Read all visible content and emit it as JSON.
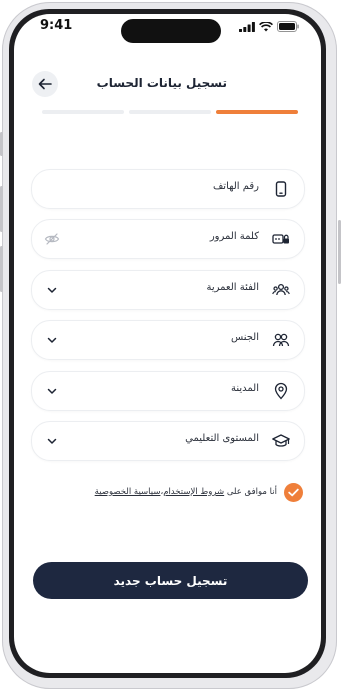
{
  "status_bar": {
    "time": "9:41"
  },
  "header": {
    "title": "تسجيل بيانات الحساب"
  },
  "progress": {
    "current_step": 1,
    "total_steps": 3
  },
  "fields": [
    {
      "label": "رقم الهاتف",
      "icon": "phone-icon",
      "left_icon": null
    },
    {
      "label": "كلمة المرور",
      "icon": "password-icon",
      "left_icon": "eye-off-icon"
    },
    {
      "label": "الفئة العمرية",
      "icon": "group-icon",
      "left_icon": "chevron-down-icon"
    },
    {
      "label": "الجنس",
      "icon": "gender-icon",
      "left_icon": "chevron-down-icon"
    },
    {
      "label": "المدينة",
      "icon": "location-pin-icon",
      "left_icon": "chevron-down-icon"
    },
    {
      "label": "المستوى التعليمي",
      "icon": "graduation-cap-icon",
      "left_icon": "chevron-down-icon"
    }
  ],
  "agreement": {
    "prefix": "أنا موافق على ",
    "terms": "شروط الإستخدام",
    "separator": "،",
    "privacy": "سياسية الخصوصية",
    "checked": true
  },
  "submit": {
    "label": "تسجيل حساب جديد"
  },
  "colors": {
    "accent": "#ef7f3a",
    "primary": "#1e2840",
    "track": "#eceef1"
  }
}
